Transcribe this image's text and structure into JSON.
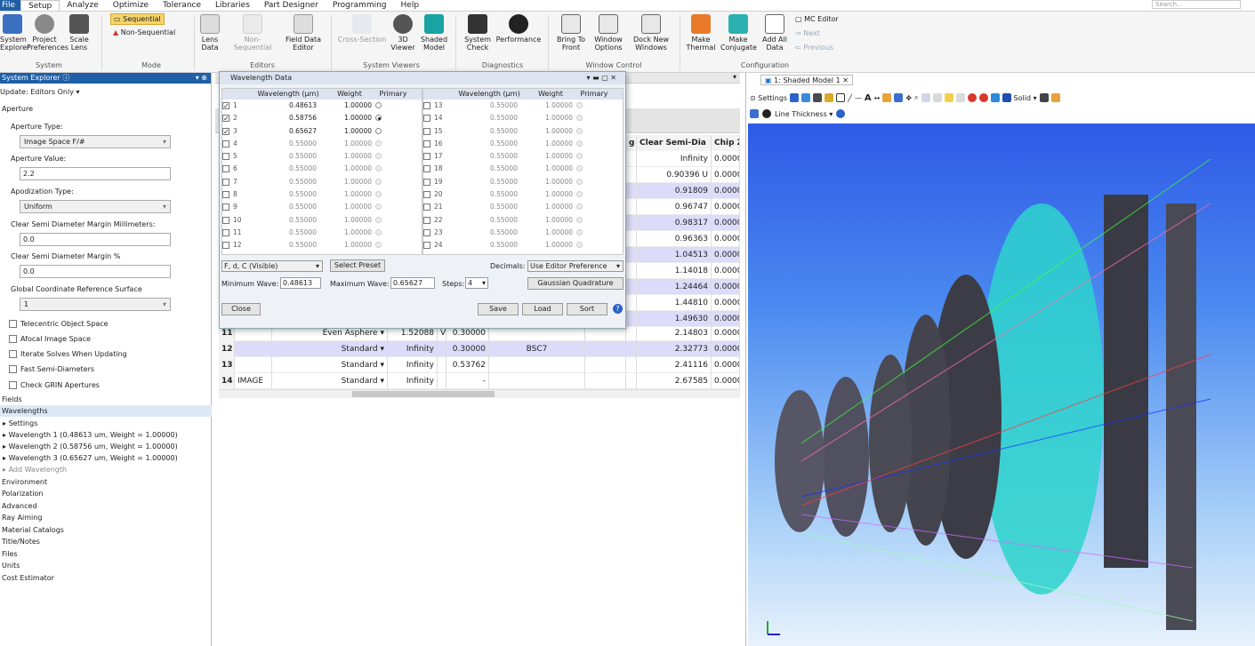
{
  "menu": {
    "items": [
      "File",
      "Setup",
      "Analyze",
      "Optimize",
      "Tolerance",
      "Libraries",
      "Part Designer",
      "Programming",
      "Help"
    ],
    "search_placeholder": "Search..."
  },
  "ribbon": {
    "system": {
      "group": "System",
      "buttons": [
        "System Explorer",
        "Project Preferences",
        "Scale Lens"
      ]
    },
    "mode": {
      "group": "Mode",
      "sequential": "Sequential",
      "non_sequential": "Non-Sequential"
    },
    "editors": {
      "group": "Editors",
      "buttons": [
        "Lens Data",
        "Non-Sequential",
        "Field Data Editor"
      ]
    },
    "viewers": {
      "group": "System Viewers",
      "buttons": [
        "Cross-Section",
        "3D Viewer",
        "Shaded Model"
      ]
    },
    "diagnostics": {
      "group": "Diagnostics",
      "buttons": [
        "System Check",
        "Performance"
      ]
    },
    "window": {
      "group": "Window Control",
      "buttons": [
        "Bring To Front",
        "Window Options",
        "Dock New Windows"
      ]
    },
    "configuration": {
      "group": "Configuration",
      "buttons": [
        "Make Thermal",
        "Make Conjugate",
        "Add All Data"
      ],
      "mc_editor": "MC Editor",
      "next": "Next",
      "previous": "Previous"
    }
  },
  "system_explorer": {
    "title": "System Explorer",
    "update": "Update: Editors Only",
    "aperture": "Aperture",
    "aperture_type_label": "Aperture Type:",
    "aperture_type": "Image Space F/#",
    "aperture_value_label": "Aperture Value:",
    "aperture_value": "2.2",
    "apodization_label": "Apodization Type:",
    "apodization": "Uniform",
    "csd_mm_label": "Clear Semi Diameter Margin Millimeters:",
    "csd_mm": "0.0",
    "csd_pct_label": "Clear Semi Diameter Margin %",
    "csd_pct": "0.0",
    "gcrs_label": "Global Coordinate Reference Surface",
    "gcrs": "1",
    "checks": [
      "Telecentric Object Space",
      "Afocal Image Space",
      "Iterate Solves When Updating",
      "Fast Semi-Diameters",
      "Check GRIN Apertures"
    ],
    "fields": "Fields",
    "wavelengths": "Wavelengths",
    "wl_settings": "Settings",
    "wl_items": [
      "Wavelength 1 (0.48613 um, Weight = 1.00000)",
      "Wavelength 2 (0.58756 um, Weight = 1.00000)",
      "Wavelength 3 (0.65627 um, Weight = 1.00000)"
    ],
    "add_wavelength": "Add Wavelength",
    "sections": [
      "Environment",
      "Polarization",
      "Advanced",
      "Ray Aiming",
      "Material Catalogs",
      "Title/Notes",
      "Files",
      "Units",
      "Cost Estimator"
    ]
  },
  "wl_dialog": {
    "title": "Wavelength Data",
    "headers": [
      "Wavelength (µm)",
      "Weight",
      "Primary"
    ],
    "left_rows": [
      {
        "n": "1",
        "wl": "0.48613",
        "w": "1.00000",
        "checked": true,
        "primary": false
      },
      {
        "n": "2",
        "wl": "0.58756",
        "w": "1.00000",
        "checked": true,
        "primary": true
      },
      {
        "n": "3",
        "wl": "0.65627",
        "w": "1.00000",
        "checked": true,
        "primary": false
      },
      {
        "n": "4",
        "wl": "0.55000",
        "w": "1.00000",
        "checked": false
      },
      {
        "n": "5",
        "wl": "0.55000",
        "w": "1.00000",
        "checked": false
      },
      {
        "n": "6",
        "wl": "0.55000",
        "w": "1.00000",
        "checked": false
      },
      {
        "n": "7",
        "wl": "0.55000",
        "w": "1.00000",
        "checked": false
      },
      {
        "n": "8",
        "wl": "0.55000",
        "w": "1.00000",
        "checked": false
      },
      {
        "n": "9",
        "wl": "0.55000",
        "w": "1.00000",
        "checked": false
      },
      {
        "n": "10",
        "wl": "0.55000",
        "w": "1.00000",
        "checked": false
      },
      {
        "n": "11",
        "wl": "0.55000",
        "w": "1.00000",
        "checked": false
      },
      {
        "n": "12",
        "wl": "0.55000",
        "w": "1.00000",
        "checked": false
      }
    ],
    "right_rows": [
      {
        "n": "13",
        "wl": "0.55000",
        "w": "1.00000"
      },
      {
        "n": "14",
        "wl": "0.55000",
        "w": "1.00000"
      },
      {
        "n": "15",
        "wl": "0.55000",
        "w": "1.00000"
      },
      {
        "n": "16",
        "wl": "0.55000",
        "w": "1.00000"
      },
      {
        "n": "17",
        "wl": "0.55000",
        "w": "1.00000"
      },
      {
        "n": "18",
        "wl": "0.55000",
        "w": "1.00000"
      },
      {
        "n": "19",
        "wl": "0.55000",
        "w": "1.00000"
      },
      {
        "n": "20",
        "wl": "0.55000",
        "w": "1.00000"
      },
      {
        "n": "21",
        "wl": "0.55000",
        "w": "1.00000"
      },
      {
        "n": "22",
        "wl": "0.55000",
        "w": "1.00000"
      },
      {
        "n": "23",
        "wl": "0.55000",
        "w": "1.00000"
      },
      {
        "n": "24",
        "wl": "0.55000",
        "w": "1.00000"
      }
    ],
    "preset": "F, d, C (Visible)",
    "select_preset": "Select Preset",
    "decimals_label": "Decimals:",
    "decimals": "Use Editor Preference",
    "min_label": "Minimum Wave:",
    "min_value": "0.48613",
    "max_label": "Maximum Wave:",
    "max_value": "0.65627",
    "steps_label": "Steps:",
    "steps": "4",
    "gaussian": "Gaussian Quadrature",
    "close": "Close",
    "save": "Save",
    "load": "Load",
    "sort": "Sort"
  },
  "lens_editor": {
    "headers": [
      "g",
      "Clear Semi-Dia",
      "Chip Z"
    ],
    "right_values": [
      {
        "csd": "Infinity",
        "chip": "0.0000"
      },
      {
        "csd": "0.90396 U",
        "chip": "0.0000"
      },
      {
        "csd": "0.91809",
        "chip": "0.0000",
        "hl": true
      },
      {
        "csd": "0.96747",
        "chip": "0.0000"
      },
      {
        "csd": "0.98317",
        "chip": "0.0000",
        "hl": true
      },
      {
        "csd": "0.96363",
        "chip": "0.0000"
      },
      {
        "csd": "1.04513",
        "chip": "0.0000",
        "hl": true
      },
      {
        "csd": "1.14018",
        "chip": "0.0000"
      },
      {
        "csd": "1.24464",
        "chip": "0.0000",
        "hl": true
      },
      {
        "csd": "1.44810",
        "chip": "0.0000"
      },
      {
        "csd": "1.49630",
        "chip": "0.0000",
        "hl": true
      }
    ],
    "rows": [
      {
        "n": "11",
        "comment": "",
        "type": "Even Asphere",
        "radius": "1.52088",
        "v": "V",
        "thick": "0.30000",
        "mat": "",
        "csd": "2.14803",
        "chip": "0.0000",
        "hl": false
      },
      {
        "n": "12",
        "comment": "",
        "type": "Standard",
        "radius": "Infinity",
        "v": "",
        "thick": "0.30000",
        "mat": "BSC7",
        "csd": "2.32773",
        "chip": "0.0000",
        "hl": true
      },
      {
        "n": "13",
        "comment": "",
        "type": "Standard",
        "radius": "Infinity",
        "v": "",
        "thick": "0.53762",
        "mat": "",
        "csd": "2.41116",
        "chip": "0.0000",
        "hl": false
      },
      {
        "n": "14",
        "comment": "IMAGE",
        "type": "Standard",
        "radius": "Infinity",
        "v": "",
        "thick": "-",
        "mat": "",
        "csd": "2.67585",
        "chip": "0.0000",
        "hl": false
      }
    ]
  },
  "viewer": {
    "tab": "1: Shaded Model 1",
    "settings": "Settings",
    "solid": "Solid",
    "line_thickness": "Line Thickness"
  }
}
